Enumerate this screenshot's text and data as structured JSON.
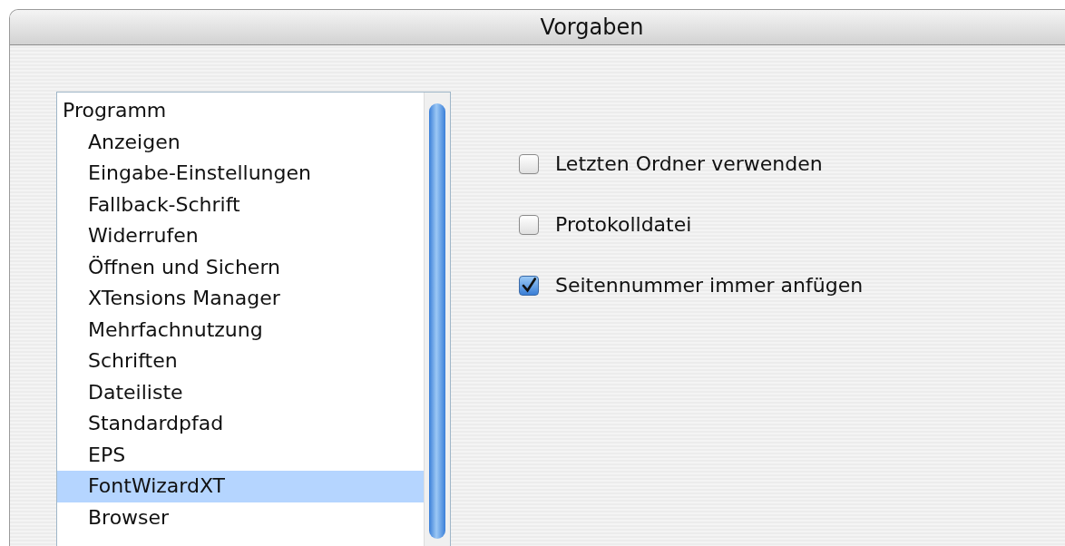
{
  "window": {
    "title": "Vorgaben"
  },
  "sidebar": {
    "items": [
      {
        "label": "Programm",
        "selected": false,
        "children": [
          {
            "label": "Anzeigen",
            "selected": false
          },
          {
            "label": "Eingabe-Einstellungen",
            "selected": false
          },
          {
            "label": "Fallback-Schrift",
            "selected": false
          },
          {
            "label": "Widerrufen",
            "selected": false
          },
          {
            "label": "Öffnen und Sichern",
            "selected": false
          },
          {
            "label": "XTensions Manager",
            "selected": false
          },
          {
            "label": "Mehrfachnutzung",
            "selected": false
          },
          {
            "label": "Schriften",
            "selected": false
          },
          {
            "label": "Dateiliste",
            "selected": false
          },
          {
            "label": "Standardpfad",
            "selected": false
          },
          {
            "label": "EPS",
            "selected": false
          },
          {
            "label": "FontWizardXT",
            "selected": true
          },
          {
            "label": "Browser",
            "selected": false
          }
        ]
      }
    ]
  },
  "options": [
    {
      "label": "Letzten Ordner verwenden",
      "checked": false
    },
    {
      "label": "Protokolldatei",
      "checked": false
    },
    {
      "label": "Seitennummer immer anfügen",
      "checked": true
    }
  ]
}
